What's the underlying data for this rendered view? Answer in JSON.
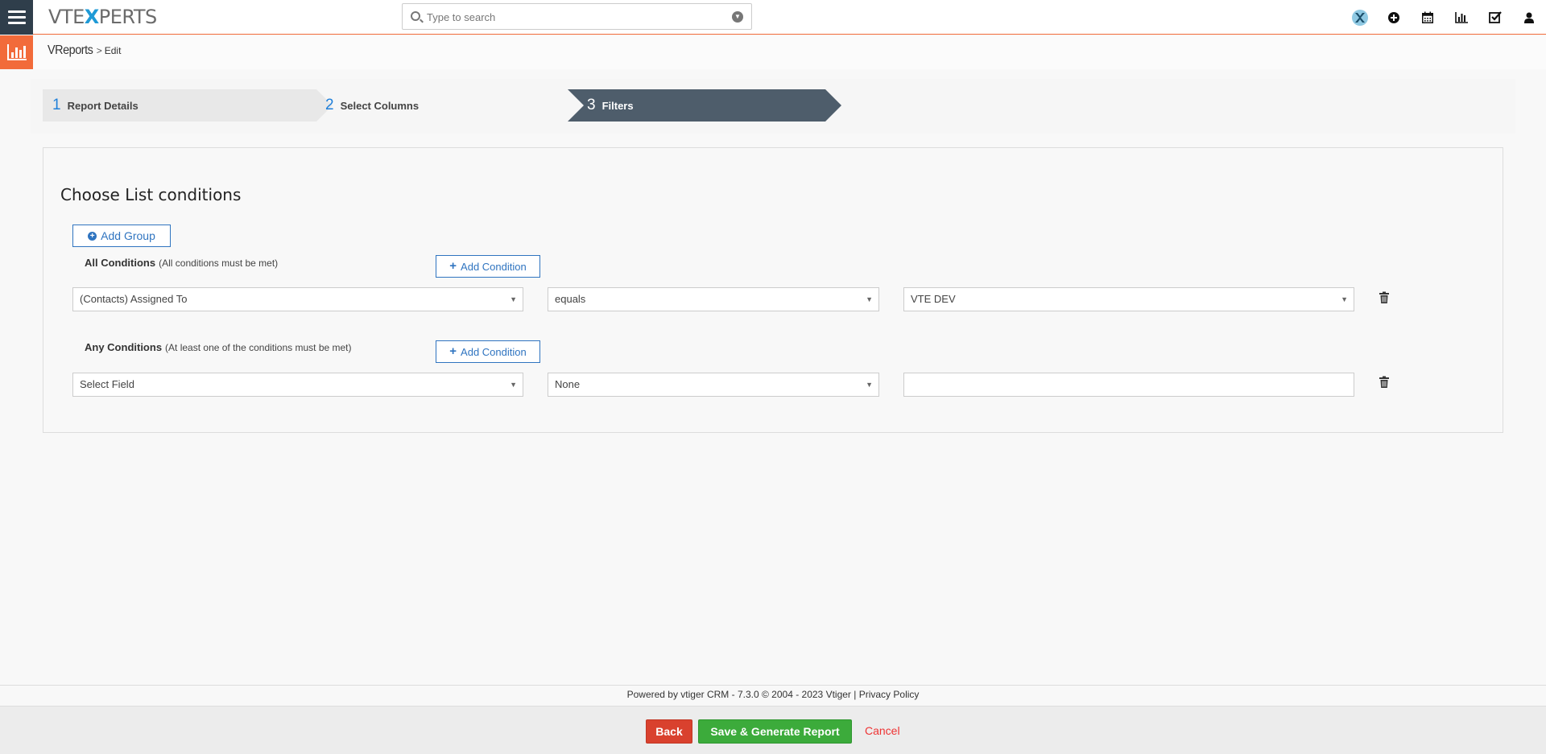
{
  "header": {
    "logo_text_1": "VTE",
    "logo_text_x": "X",
    "logo_text_2": "PERTS",
    "search_placeholder": "Type to search"
  },
  "topicons": [
    "vtexperts-icon",
    "add-icon",
    "calendar-icon",
    "reports-icon",
    "tasks-icon",
    "user-icon"
  ],
  "breadcrumb": {
    "module": "VReports",
    "separator": ">",
    "current": "Edit"
  },
  "steps": [
    {
      "num": "1",
      "label": "Report Details"
    },
    {
      "num": "2",
      "label": "Select Columns"
    },
    {
      "num": "3",
      "label": "Filters"
    }
  ],
  "panel": {
    "title": "Choose List conditions",
    "add_group": "Add Group",
    "add_condition": "Add Condition",
    "all": {
      "label": "All Conditions",
      "hint": "(All conditions must be met)",
      "field": "(Contacts) Assigned To",
      "operator": "equals",
      "value": "VTE DEV"
    },
    "any": {
      "label": "Any Conditions",
      "hint": "(At least one of the conditions must be met)",
      "field": "Select Field",
      "operator": "None",
      "value": ""
    }
  },
  "footer": {
    "powered": "Powered by vtiger CRM - 7.3.0  © 2004 - 2023 ",
    "vtiger_link": "Vtiger",
    "sep": " | ",
    "privacy_link": "Privacy Policy"
  },
  "actions": {
    "back": "Back",
    "save": "Save & Generate Report",
    "cancel": "Cancel"
  },
  "colors": {
    "accent": "#f26b3a",
    "nav_dark": "#2f3e4b",
    "step_active": "#4e5d6b",
    "link_blue": "#2f74c0",
    "back_red": "#d9412e",
    "save_green": "#3cab3b"
  }
}
